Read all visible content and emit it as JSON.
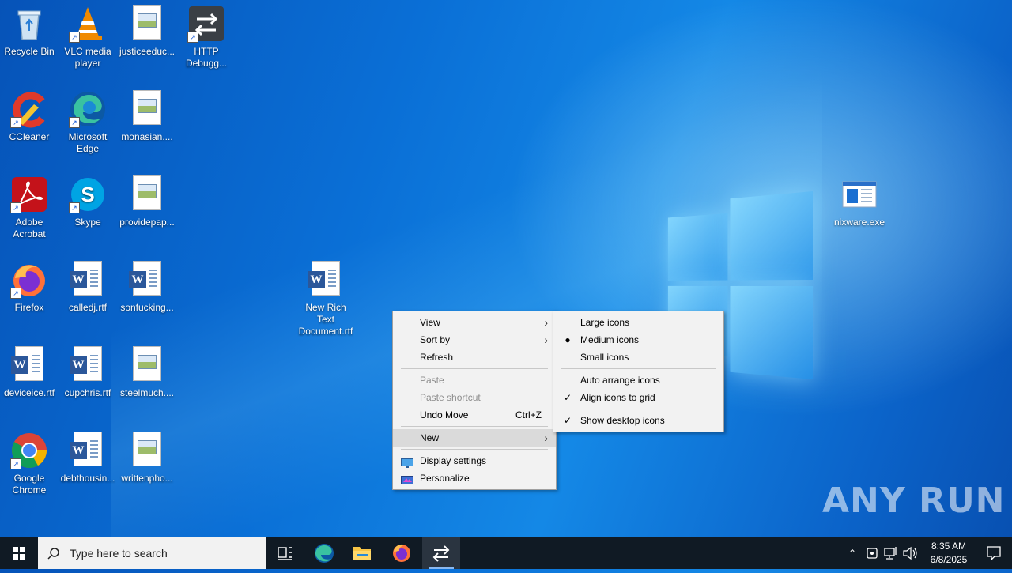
{
  "desktop": {
    "icons": [
      {
        "label": "Recycle Bin"
      },
      {
        "label": "VLC media player"
      },
      {
        "label": "justiceeduc..."
      },
      {
        "label": "HTTP Debugg..."
      },
      {
        "label": "CCleaner"
      },
      {
        "label": "Microsoft Edge"
      },
      {
        "label": "monasian...."
      },
      {
        "label": "Adobe Acrobat"
      },
      {
        "label": "Skype"
      },
      {
        "label": "providepap..."
      },
      {
        "label": "Firefox"
      },
      {
        "label": "calledj.rtf"
      },
      {
        "label": "sonfucking..."
      },
      {
        "label": "deviceice.rtf"
      },
      {
        "label": "cupchris.rtf"
      },
      {
        "label": "steelmuch...."
      },
      {
        "label": "Google Chrome"
      },
      {
        "label": "debthousin..."
      },
      {
        "label": "writtenpho..."
      },
      {
        "label": "New Rich Text Document.rtf"
      },
      {
        "label": "nixware.exe"
      }
    ]
  },
  "context_menu": {
    "items": [
      {
        "label": "View"
      },
      {
        "label": "Sort by"
      },
      {
        "label": "Refresh"
      },
      {
        "label": "Paste"
      },
      {
        "label": "Paste shortcut"
      },
      {
        "label": "Undo Move",
        "shortcut": "Ctrl+Z"
      },
      {
        "label": "New"
      },
      {
        "label": "Display settings"
      },
      {
        "label": "Personalize"
      }
    ]
  },
  "view_submenu": {
    "items": [
      {
        "label": "Large icons"
      },
      {
        "label": "Medium icons",
        "selected": true
      },
      {
        "label": "Small icons"
      },
      {
        "label": "Auto arrange icons"
      },
      {
        "label": "Align icons to grid",
        "checked": true
      },
      {
        "label": "Show desktop icons",
        "checked": true
      }
    ]
  },
  "taskbar": {
    "search_placeholder": "Type here to search",
    "clock_time": "8:35 AM",
    "clock_date": "6/8/2025"
  },
  "watermark": "ANY RUN"
}
